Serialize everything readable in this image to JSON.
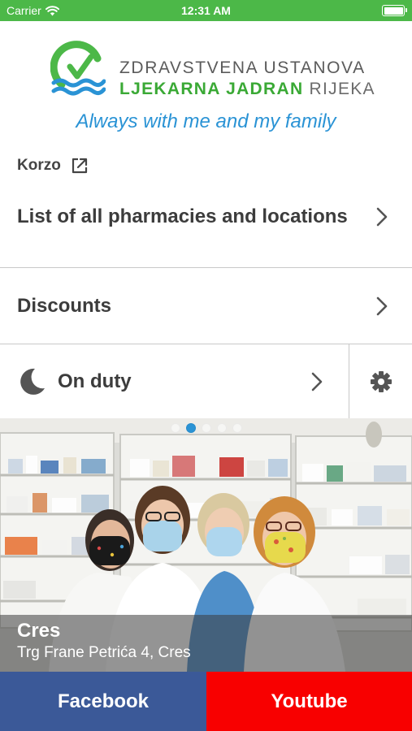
{
  "status_bar": {
    "carrier": "Carrier",
    "time": "12:31 AM",
    "battery_level": 1.0
  },
  "brand": {
    "line1": "ZDRAVSTVENA USTANOVA",
    "line2_green": "LJEKARNA JADRAN",
    "line2_grey": " RIJEKA",
    "slogan": "Always with me and my family",
    "colors": {
      "green": "#3aa935",
      "blue": "#2a93d5",
      "grey": "#5b5b5b"
    }
  },
  "current_pharmacy": {
    "name": "Korzo",
    "icon": "external-link-icon"
  },
  "menu": {
    "pharmacies_label": "List of all pharmacies and locations",
    "discounts_label": "Discounts",
    "on_duty_label": "On duty",
    "on_duty_icon": "moon-icon",
    "settings_icon": "gear-icon",
    "chevron_icon": "chevron-right-icon"
  },
  "carousel": {
    "page_count": 5,
    "active_page": 2,
    "city": "Cres",
    "address": "Trg Frane Petrića 4, Cres"
  },
  "buttons": {
    "facebook": "Facebook",
    "youtube": "Youtube",
    "colors": {
      "facebook": "#3b5998",
      "youtube": "#f80000"
    }
  },
  "theme": {
    "status_bar_color": "#4cb848",
    "divider_color": "#c8c8c8"
  }
}
